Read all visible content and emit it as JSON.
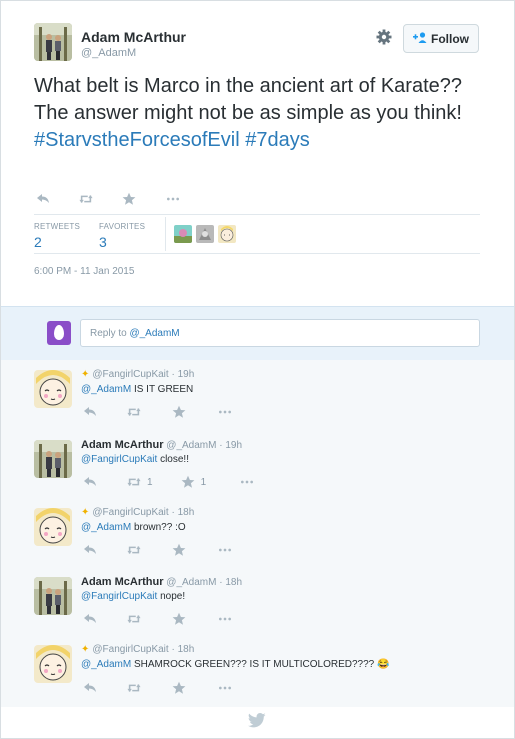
{
  "tweet": {
    "author_name": "Adam McArthur",
    "author_handle": "@_AdamM",
    "follow_label": "Follow",
    "text_plain": "What belt is Marco in the ancient art of Karate?? The answer might not be as simple as you think!",
    "hashtag_1": "#StarvstheForcesofEvil",
    "hashtag_2": "#7days",
    "retweets_label": "RETWEETS",
    "retweets_count": "2",
    "favorites_label": "FAVORITES",
    "favorites_count": "3",
    "timestamp": "6:00 PM - 11 Jan 2015"
  },
  "reply_box": {
    "prefix": "Reply to ",
    "mention": "@_AdamM"
  },
  "replies": [
    {
      "author_name": "",
      "author_handle": "@FangirlCupKait",
      "time": "19h",
      "mention": "@_AdamM",
      "text": " IS IT GREEN",
      "retweets": "",
      "favorites": ""
    },
    {
      "author_name": "Adam McArthur",
      "author_handle": "@_AdamM",
      "time": "19h",
      "mention": "@FangirlCupKait",
      "text": " close!!",
      "retweets": "1",
      "favorites": "1"
    },
    {
      "author_name": "",
      "author_handle": "@FangirlCupKait",
      "time": "18h",
      "mention": "@_AdamM",
      "text": " brown?? :O",
      "retweets": "",
      "favorites": ""
    },
    {
      "author_name": "Adam McArthur",
      "author_handle": "@_AdamM",
      "time": "18h",
      "mention": "@FangirlCupKait",
      "text": " nope!",
      "retweets": "",
      "favorites": ""
    },
    {
      "author_name": "",
      "author_handle": "@FangirlCupKait",
      "time": "18h",
      "mention": "@_AdamM",
      "text": " SHAMROCK GREEN??? IS IT MULTICOLORED???? 😂",
      "retweets": "",
      "favorites": ""
    }
  ],
  "icons": {
    "reply": "reply-icon",
    "retweet": "retweet-icon",
    "favorite": "star-icon",
    "more": "more-icon",
    "settings": "gear-icon",
    "follow": "add-person-icon",
    "brand": "twitter-bird-icon"
  },
  "colors": {
    "link": "#2b7bb9",
    "reply_bg": "#e8f2fa",
    "muted": "#8899a6",
    "egg": "#8a4ec8"
  }
}
